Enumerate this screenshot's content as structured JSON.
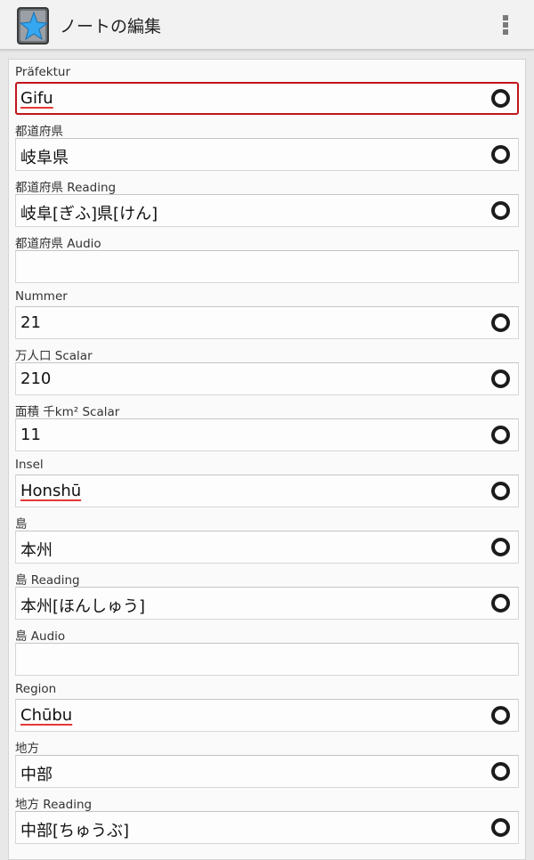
{
  "app": {
    "title": "ノートの編集",
    "accent": "#c0151b",
    "icon": "ankidroid-star-icon",
    "overflow_icon": "overflow-menu-icon"
  },
  "fields": [
    {
      "label": "Präfektur",
      "value": "Gifu",
      "has_media": true,
      "active": true,
      "spell": true
    },
    {
      "label": "都道府県",
      "value": "岐阜県",
      "has_media": true
    },
    {
      "label": "都道府県 Reading",
      "value": "岐阜[ぎふ]県[けん]",
      "has_media": true
    },
    {
      "label": "都道府県 Audio",
      "value": "",
      "has_media": false
    },
    {
      "label": "Nummer",
      "value": "21",
      "has_media": true
    },
    {
      "label": "万人口 Scalar",
      "value": "210",
      "has_media": true
    },
    {
      "label": "面積 千km² Scalar",
      "value": "11",
      "has_media": true
    },
    {
      "label": "Insel",
      "value": "Honshū",
      "has_media": true,
      "spell": true
    },
    {
      "label": "島",
      "value": "本州",
      "has_media": true
    },
    {
      "label": "島 Reading",
      "value": "本州[ほんしゅう]",
      "has_media": true
    },
    {
      "label": "島 Audio",
      "value": "",
      "has_media": false
    },
    {
      "label": "Region",
      "value": "Chūbu",
      "has_media": true,
      "spell": true
    },
    {
      "label": "地方",
      "value": "中部",
      "has_media": true
    },
    {
      "label": "地方 Reading",
      "value": "中部[ちゅうぶ]",
      "has_media": true
    }
  ]
}
